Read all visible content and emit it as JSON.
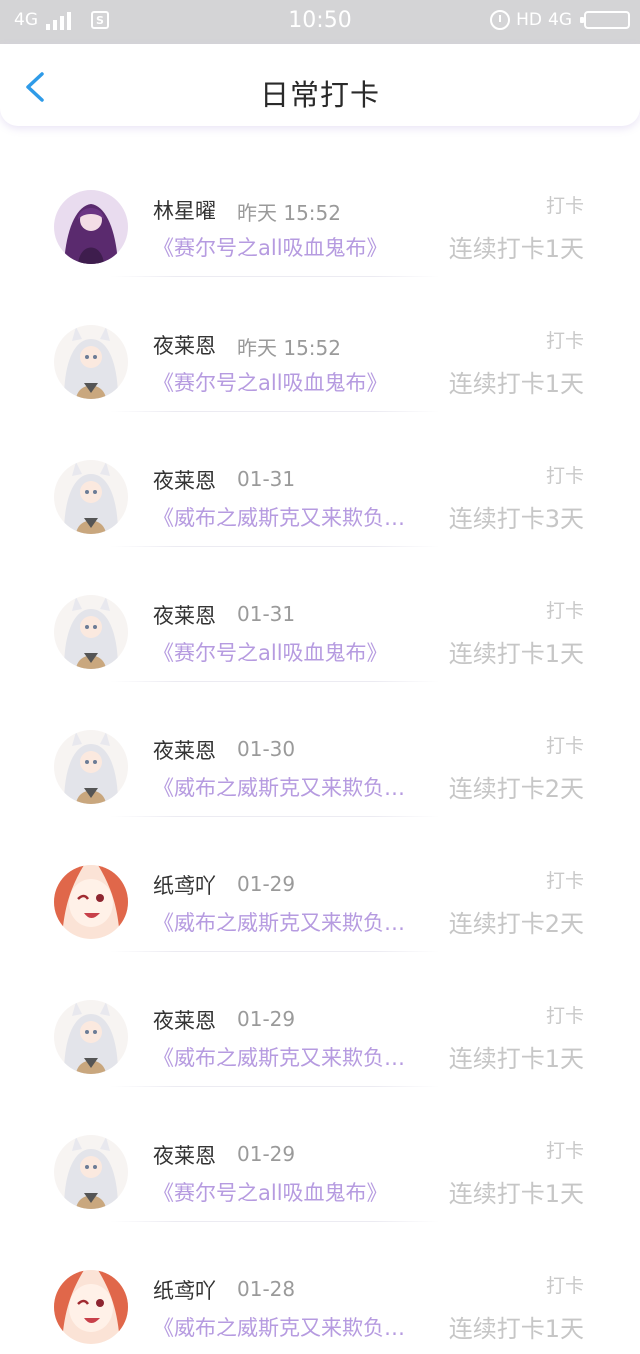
{
  "status_bar": {
    "network_left": "4G",
    "time": "10:50",
    "hd": "HD",
    "network_right": "4G"
  },
  "header": {
    "title": "日常打卡"
  },
  "items": [
    {
      "name": "林星曜",
      "time": "昨天 15:52",
      "book": "《赛尔号之all吸血鬼布》",
      "tag": "打卡",
      "streak": "连续打卡1天",
      "avatar": "avatar-purple"
    },
    {
      "name": "夜莱恩",
      "time": "昨天 15:52",
      "book": "《赛尔号之all吸血鬼布》",
      "tag": "打卡",
      "streak": "连续打卡1天",
      "avatar": "avatar-white-hair"
    },
    {
      "name": "夜莱恩",
      "time": "01-31",
      "book": "《威布之威斯克又来欺负…",
      "tag": "打卡",
      "streak": "连续打卡3天",
      "avatar": "avatar-white-hair"
    },
    {
      "name": "夜莱恩",
      "time": "01-31",
      "book": "《赛尔号之all吸血鬼布》",
      "tag": "打卡",
      "streak": "连续打卡1天",
      "avatar": "avatar-white-hair"
    },
    {
      "name": "夜莱恩",
      "time": "01-30",
      "book": "《威布之威斯克又来欺负…",
      "tag": "打卡",
      "streak": "连续打卡2天",
      "avatar": "avatar-white-hair"
    },
    {
      "name": "纸鸢吖",
      "time": "01-29",
      "book": "《威布之威斯克又来欺负…",
      "tag": "打卡",
      "streak": "连续打卡2天",
      "avatar": "avatar-winking"
    },
    {
      "name": "夜莱恩",
      "time": "01-29",
      "book": "《威布之威斯克又来欺负…",
      "tag": "打卡",
      "streak": "连续打卡1天",
      "avatar": "avatar-white-hair"
    },
    {
      "name": "夜莱恩",
      "time": "01-29",
      "book": "《赛尔号之all吸血鬼布》",
      "tag": "打卡",
      "streak": "连续打卡1天",
      "avatar": "avatar-white-hair"
    },
    {
      "name": "纸鸢吖",
      "time": "01-28",
      "book": "《威布之威斯克又来欺负…",
      "tag": "打卡",
      "streak": "连续打卡1天",
      "avatar": "avatar-winking"
    }
  ],
  "colors": {
    "status_bar": "#d4d4d6",
    "accent_back": "#2f9be8",
    "book_title": "#b69be0"
  }
}
